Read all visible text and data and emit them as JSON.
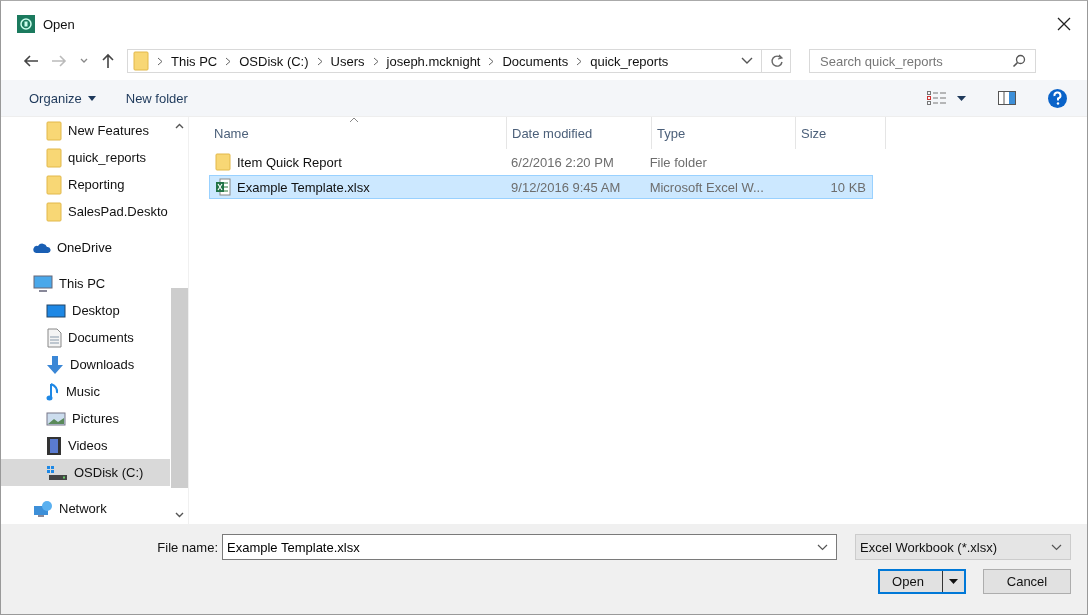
{
  "window": {
    "title": "Open"
  },
  "address": {
    "crumbs": [
      "This PC",
      "OSDisk (C:)",
      "Users",
      "joseph.mcknight",
      "Documents",
      "quick_reports"
    ]
  },
  "search": {
    "placeholder": "Search quick_reports"
  },
  "toolbar": {
    "organize": "Organize",
    "new_folder": "New folder"
  },
  "sidebar": {
    "folders": [
      {
        "label": "New Features",
        "kind": "folder",
        "selected": false
      },
      {
        "label": "quick_reports",
        "kind": "folder",
        "selected": false
      },
      {
        "label": "Reporting",
        "kind": "folder",
        "selected": false
      },
      {
        "label": "SalesPad.Deskto",
        "kind": "folder",
        "selected": false
      }
    ],
    "tree": [
      {
        "label": "OneDrive",
        "kind": "cloud",
        "selected": false
      },
      {
        "label": "This PC",
        "kind": "pc",
        "selected": false,
        "children": [
          {
            "label": "Desktop",
            "kind": "desktop",
            "selected": false
          },
          {
            "label": "Documents",
            "kind": "document",
            "selected": false
          },
          {
            "label": "Downloads",
            "kind": "download",
            "selected": false
          },
          {
            "label": "Music",
            "kind": "music",
            "selected": false
          },
          {
            "label": "Pictures",
            "kind": "pictures",
            "selected": false
          },
          {
            "label": "Videos",
            "kind": "videos",
            "selected": false
          },
          {
            "label": "OSDisk (C:)",
            "kind": "disk",
            "selected": true
          }
        ]
      },
      {
        "label": "Network",
        "kind": "network",
        "selected": false
      }
    ]
  },
  "table": {
    "columns": [
      "Name",
      "Date modified",
      "Type",
      "Size"
    ],
    "rows": [
      {
        "name": "Item Quick Report",
        "date": "6/2/2016 2:20 PM",
        "type": "File folder",
        "kind": "folder",
        "selected": false
      },
      {
        "name": "Example Template.xlsx",
        "date": "9/12/2016 9:45 AM",
        "type": "Microsoft Excel W...",
        "size": "10 KB",
        "kind": "excel",
        "selected": true
      }
    ]
  },
  "footer": {
    "file_name_label": "File name:",
    "file_name": "Example Template.xlsx",
    "filter": "Excel Workbook (*.xlsx)",
    "open": "Open",
    "cancel": "Cancel"
  }
}
